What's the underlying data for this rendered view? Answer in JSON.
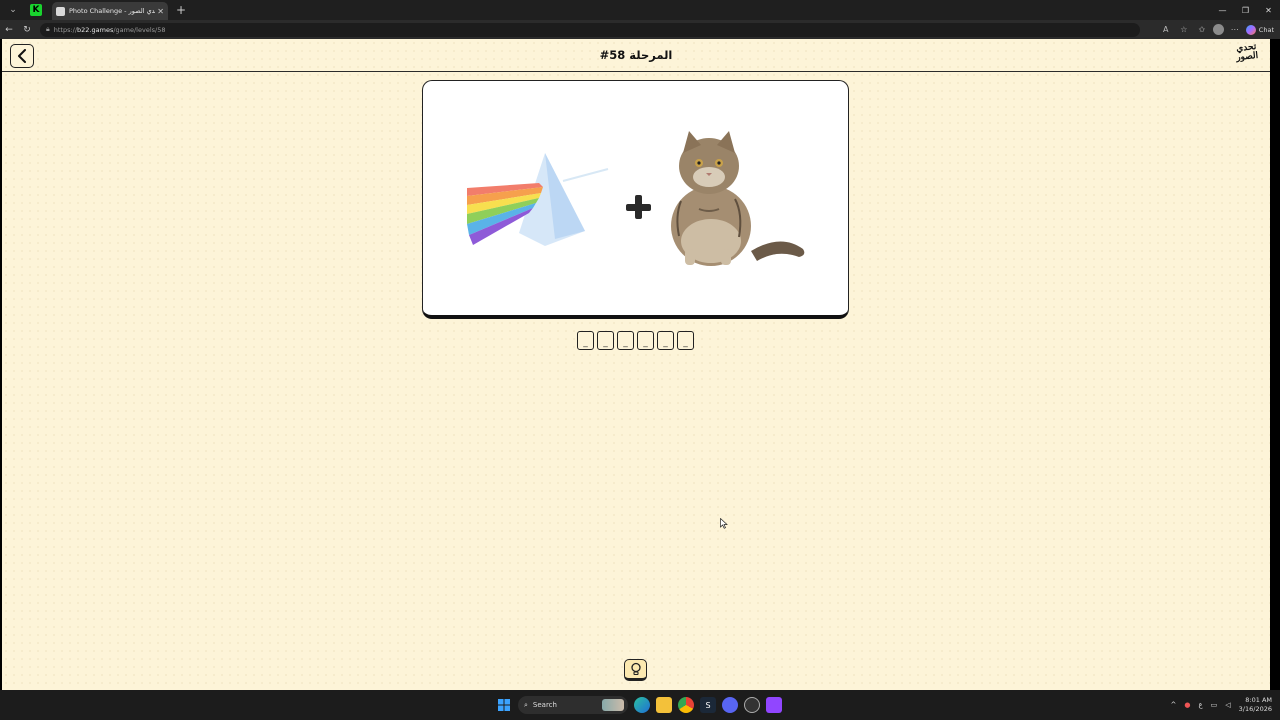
{
  "browser": {
    "tab_title": "Photo Challenge - لعبة تحدي الصور",
    "url_prefix": "https://",
    "url_domain": "b22.games",
    "url_path": "/game/levels/58",
    "chat_label": "Chat"
  },
  "game": {
    "level_title": "المرحلة 58#",
    "logo_text_line1": "تحدي",
    "logo_text_line2": "الصور",
    "answer_slots": [
      "_",
      "_",
      "_",
      "_",
      "_",
      "_"
    ],
    "plus_symbol": "+"
  },
  "taskbar": {
    "search_placeholder": "Search",
    "lang": "ع",
    "time": "8:01 AM",
    "date": "3/16/2026"
  },
  "colors": {
    "page_bg": "#fdf4d8",
    "hint_bg": "#fce9b0",
    "border": "#222222"
  }
}
